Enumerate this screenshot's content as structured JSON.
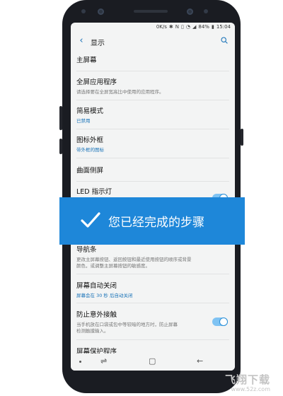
{
  "status_bar": {
    "speed": "0K/s",
    "battery": "84%",
    "time": "15:04"
  },
  "app_bar": {
    "title": "显示"
  },
  "settings": [
    {
      "title": "主屏幕",
      "subtitle": ""
    },
    {
      "title": "全屏应用程序",
      "subtitle": "请选择要在全屏宽高比中使用的应用程序。"
    },
    {
      "title": "简易模式",
      "subtitle": "已禁用"
    },
    {
      "title": "图标外框",
      "subtitle": "带外框的图标"
    },
    {
      "title": "曲面侧屏",
      "subtitle": ""
    },
    {
      "title": "LED 指示灯",
      "subtitle": ""
    },
    {
      "title": "导航条",
      "subtitle_line1": "更改主屏幕按钮、返回按钮和最近使用按钮的顺序或背景",
      "subtitle_line2": "颜色，或调整主屏幕按钮的敏感度。"
    },
    {
      "title": "屏幕自动关闭",
      "subtitle": "屏幕会在 30 秒 后自动关闭"
    },
    {
      "title": "防止意外接触",
      "subtitle_line1": "当手机放在口袋或包中等较暗的地方时，防止屏幕",
      "subtitle_line2": "检测触摸输入。"
    },
    {
      "title": "屏幕保护程序",
      "subtitle": ""
    }
  ],
  "toggles": {
    "led_indicator": true,
    "accidental_touch": true
  },
  "banner": {
    "text": "您已经完成的步骤"
  },
  "watermark": {
    "text": "飞翔下载",
    "url": "www.52z.com"
  },
  "colors": {
    "accent": "#1a73b8",
    "banner": "#1e87d9",
    "toggle_on": "#7fc3f3"
  }
}
